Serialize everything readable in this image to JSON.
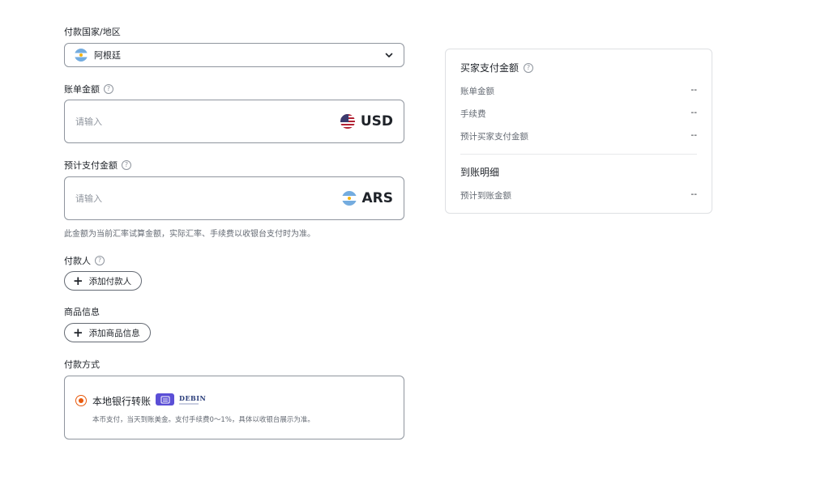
{
  "country": {
    "label": "付款国家/地区",
    "selected": "阿根廷"
  },
  "bill_amount": {
    "label": "账单金额",
    "placeholder": "请输入",
    "currency": "USD"
  },
  "expected_payment": {
    "label": "预计支付金额",
    "placeholder": "请输入",
    "currency": "ARS",
    "note": "此金额为当前汇率试算金额，实际汇率、手续费以收银台支付时为准。"
  },
  "payer": {
    "label": "付款人",
    "button_label": "添加付款人"
  },
  "product": {
    "label": "商品信息",
    "button_label": "添加商品信息"
  },
  "payment_method": {
    "label": "付款方式",
    "option_title": "本地银行转账",
    "logo_text": "DEBIN",
    "description": "本币支付，当天到账美金。支付手续费0～1%，具体以收银台展示为准。"
  },
  "summary": {
    "title": "买家支付金额",
    "rows": [
      {
        "label": "账单金额",
        "value": "--"
      },
      {
        "label": "手续费",
        "value": "--"
      },
      {
        "label": "预计买家支付金额",
        "value": "--"
      }
    ],
    "settlement_title": "到账明细",
    "settlement_rows": [
      {
        "label": "预计到账金额",
        "value": "--"
      }
    ]
  },
  "colors": {
    "accent": "#e8590c",
    "bank_icon": "#5b4fd6"
  },
  "icons": [
    "argentina-flag-icon",
    "chevron-down-icon",
    "help-icon",
    "us-flag-icon",
    "plus-icon",
    "bank-icon"
  ]
}
